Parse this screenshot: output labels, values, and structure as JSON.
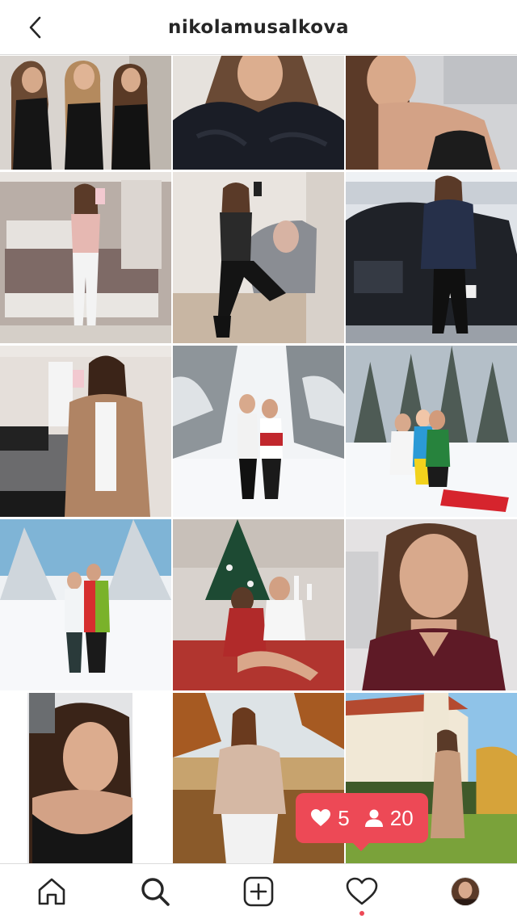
{
  "header": {
    "username": "nikolamusalkova",
    "back_icon": "chevron-left-icon"
  },
  "grid": {
    "tile_count": 15,
    "tiles": [
      {
        "icon": "photo-three-women-black-outfits"
      },
      {
        "icon": "photo-woman-black-fur-coat"
      },
      {
        "icon": "photo-woman-black-lace-top"
      },
      {
        "icon": "photo-woman-pink-top-bedroom-mirror"
      },
      {
        "icon": "photo-woman-sheer-top-armchair"
      },
      {
        "icon": "photo-woman-fur-vest-black-car"
      },
      {
        "icon": "photo-woman-camel-coat-mirror"
      },
      {
        "icon": "photo-couple-snowy-forest"
      },
      {
        "icon": "photo-group-sled-snow"
      },
      {
        "icon": "photo-couple-snow-ski-jackets"
      },
      {
        "icon": "photo-couple-christmas-tree"
      },
      {
        "icon": "photo-woman-burgundy-choker-selfie"
      },
      {
        "icon": "photo-woman-black-lingerie-selfie"
      },
      {
        "icon": "photo-woman-sweater-autumn-park"
      },
      {
        "icon": "photo-woman-beige-dress-castle"
      }
    ]
  },
  "notification": {
    "likes": "5",
    "followers": "20",
    "like_icon": "heart-icon",
    "follower_icon": "person-icon",
    "color": "#ed4956"
  },
  "bottom_nav": {
    "items": [
      {
        "icon": "home-icon"
      },
      {
        "icon": "search-icon"
      },
      {
        "icon": "add-post-icon"
      },
      {
        "icon": "activity-heart-icon"
      },
      {
        "icon": "profile-avatar"
      }
    ]
  },
  "colors": {
    "accent": "#ed4956",
    "text": "#262626",
    "border": "#dbdbdb"
  }
}
